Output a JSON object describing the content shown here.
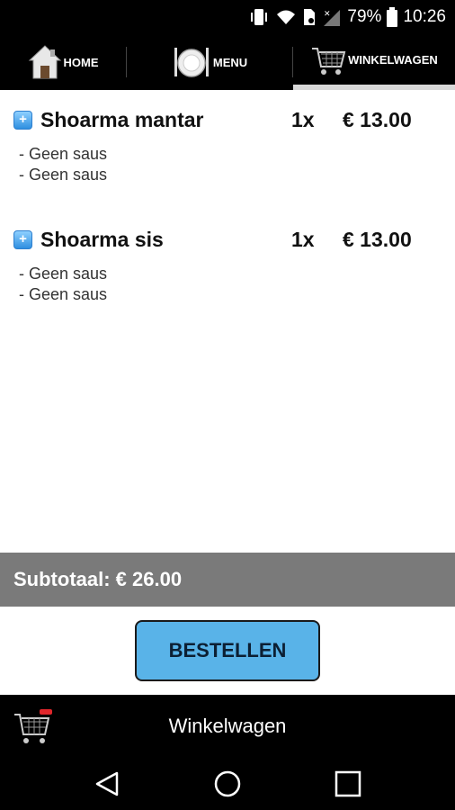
{
  "status": {
    "battery": "79%",
    "time": "10:26"
  },
  "tabs": [
    {
      "label": "HOME",
      "icon": "home-icon"
    },
    {
      "label": "MENU",
      "icon": "plate-cutlery-icon"
    },
    {
      "label": "WINKELWAGEN",
      "icon": "shopping-cart-icon",
      "active": true
    }
  ],
  "cart": {
    "items": [
      {
        "name": "Shoarma mantar",
        "qty": "1x",
        "price": "€ 13.00",
        "options": [
          "- Geen saus",
          "- Geen saus"
        ]
      },
      {
        "name": "Shoarma sis",
        "qty": "1x",
        "price": "€ 13.00",
        "options": [
          "- Geen saus",
          "- Geen saus"
        ]
      }
    ],
    "subtotal": "Subtotaal: € 26.00",
    "order_button": "BESTELLEN"
  },
  "bottom": {
    "title": "Winkelwagen"
  },
  "colors": {
    "accent_blue": "#59b3e8",
    "subtotal_gray": "#7a7a7a",
    "cart_badge_red": "#e0262b"
  }
}
